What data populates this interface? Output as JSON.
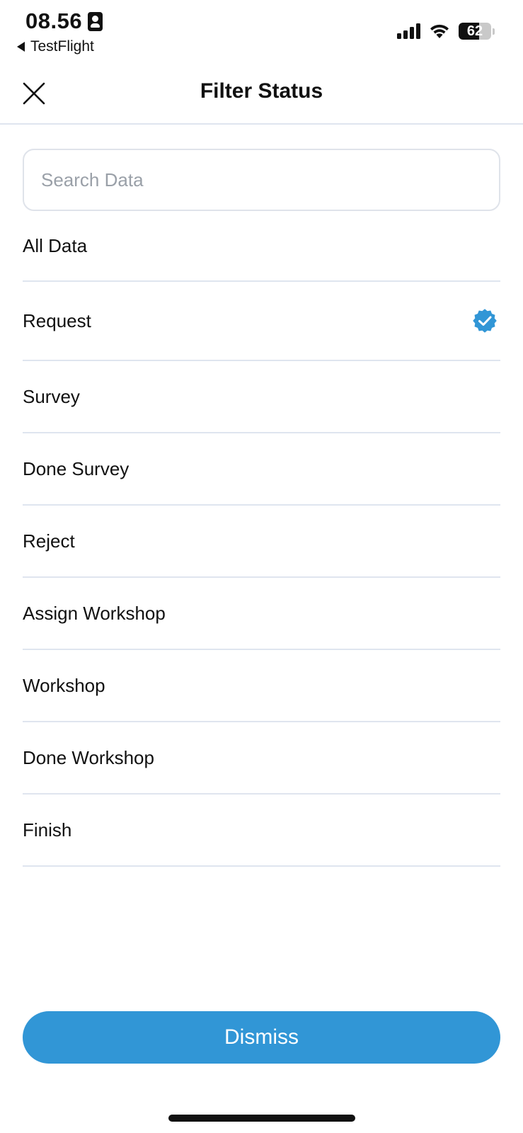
{
  "status_bar": {
    "time": "08.56",
    "back_app": "TestFlight",
    "battery_level": "62",
    "battery_fraction": 0.62,
    "icons": [
      "id-badge-icon",
      "signal-icon",
      "wifi-icon",
      "battery-icon"
    ]
  },
  "header": {
    "title": "Filter Status",
    "close_icon": "close-icon"
  },
  "search": {
    "placeholder": "Search Data",
    "value": ""
  },
  "filter_options": [
    {
      "label": "All Data",
      "selected": false
    },
    {
      "label": "Request",
      "selected": true
    },
    {
      "label": "Survey",
      "selected": false
    },
    {
      "label": "Done Survey",
      "selected": false
    },
    {
      "label": "Reject",
      "selected": false
    },
    {
      "label": "Assign Workshop",
      "selected": false
    },
    {
      "label": "Workshop",
      "selected": false
    },
    {
      "label": "Done Workshop",
      "selected": false
    },
    {
      "label": "Finish",
      "selected": false
    }
  ],
  "dismiss_label": "Dismiss",
  "colors": {
    "accent": "#3196d6",
    "divider": "#dfe5ef",
    "placeholder": "#9aa0a8",
    "text": "#111111"
  }
}
